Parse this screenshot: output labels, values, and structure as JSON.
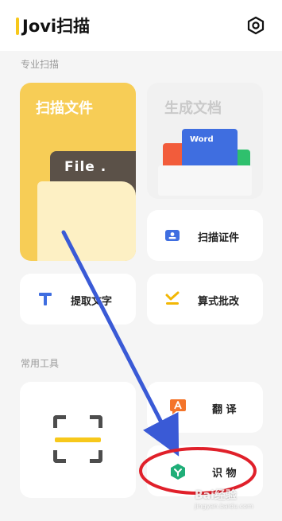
{
  "header": {
    "title": "Jovi扫描",
    "settings_icon": "gear-icon"
  },
  "sections": {
    "pro_scan": "专业扫描",
    "common_tools": "常用工具"
  },
  "cards": {
    "scan_file": {
      "label": "扫描文件",
      "folder_label": "File ."
    },
    "generate_doc": {
      "label": "生成文档",
      "doc_label": "Word"
    },
    "scan_id": {
      "label": "扫描证件",
      "icon": "id-card-icon"
    },
    "extract_text": {
      "label": "提取文字",
      "icon": "text-t-icon"
    },
    "calc_grading": {
      "label": "算式批改",
      "icon": "check-icon"
    },
    "translate": {
      "label": "翻  译",
      "icon": "translate-icon"
    },
    "recognize": {
      "label": "识  物",
      "icon": "leaf-hex-icon"
    }
  },
  "colors": {
    "accent": "#f7c81b",
    "annotation": "#e0202a",
    "arrow": "#3a5ad6"
  },
  "watermark": {
    "text": "Bai经验",
    "sub": "jingyan.baidu.com"
  }
}
